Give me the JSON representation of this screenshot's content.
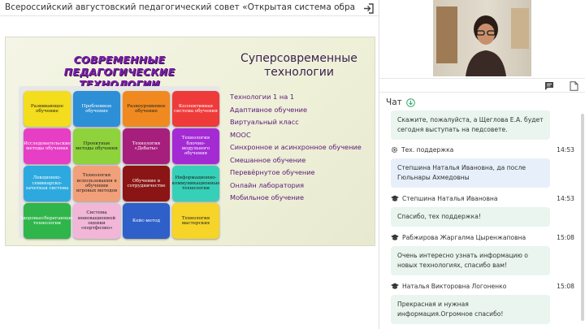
{
  "window": {
    "title": "Всероссийский августовский педагогический совет «Открытая система образования: от кон...",
    "exit_icon": "exit-icon"
  },
  "slide": {
    "banner_line1": "СОВРЕМЕННЫЕ ПЕДАГОГИЧЕСКИЕ",
    "banner_line2": "ТЕХНОЛОГИИ",
    "title_line1": "Суперсовременные",
    "title_line2": "технологии",
    "pieces": [
      {
        "label": "Развивающее обучение",
        "color": "#f3dd1c",
        "text_color": "#222222"
      },
      {
        "label": "Проблемное обучение",
        "color": "#2d8fd6",
        "text_color": "#ffffff"
      },
      {
        "label": "Разноуровневое обучение",
        "color": "#f08a20",
        "text_color": "#222222"
      },
      {
        "label": "Коллективная система обучения",
        "color": "#ef3a3a",
        "text_color": "#ffffff"
      },
      {
        "label": "Исследовательские методы обучения",
        "color": "#e63ec4",
        "text_color": "#ffffff"
      },
      {
        "label": "Проектные методы обучения",
        "color": "#8ed23c",
        "text_color": "#222222"
      },
      {
        "label": "Технология «Дебаты»",
        "color": "#a71f7c",
        "text_color": "#ffffff"
      },
      {
        "label": "Технология блочно-модульного обучения",
        "color": "#a42bd4",
        "text_color": "#ffffff"
      },
      {
        "label": "Лекционно-семинарско-зачетная система",
        "color": "#2da9df",
        "text_color": "#ffffff"
      },
      {
        "label": "Технология использования в обучении игровых методов",
        "color": "#f2a07a",
        "text_color": "#222222"
      },
      {
        "label": "Обучение в сотрудничестве",
        "color": "#8b1515",
        "text_color": "#ffffff"
      },
      {
        "label": "Информационно-коммуникационные технологии",
        "color": "#36d0b8",
        "text_color": "#222222"
      },
      {
        "label": "Здоровьесберегающие технологии",
        "color": "#2fb54a",
        "text_color": "#ffffff"
      },
      {
        "label": "Система инновационной оценки «портфолио»",
        "color": "#f2b6d9",
        "text_color": "#222222"
      },
      {
        "label": "Кейс-метод",
        "color": "#2f5fc8",
        "text_color": "#ffffff"
      },
      {
        "label": "Технология мастерских",
        "color": "#f6d428",
        "text_color": "#222222"
      }
    ],
    "list": [
      "Технологии 1 на 1",
      "Адаптивное обучение",
      "Виртуальный класс",
      "МООС",
      "Синхронное и асинхронное обучение",
      "Смешанное обучение",
      "Перевёрнутое обучение",
      "Онлайн лаборатория",
      "Мобильное обучение"
    ]
  },
  "panel": {
    "chat_tab_icon": "chat-bubble-icon",
    "files_tab_icon": "document-icon",
    "chat_label": "Чат",
    "chat_header_icon": "arrow-down-circle-icon"
  },
  "messages": [
    {
      "author": "",
      "time": "",
      "icon": "",
      "text": "Скажите, пожалуйста, а Щеглова Е.А. будет сегодня выступать на педсовете.",
      "style": "green"
    },
    {
      "author": "Тех. поддержка",
      "time": "14:53",
      "icon": "gear-icon",
      "text": "Степшина Наталья Ивановна, да после Гюльнары Ахмедовны",
      "style": "blue"
    },
    {
      "author": "Степшина Наталья Ивановна",
      "time": "14:53",
      "icon": "graduation-cap-icon",
      "text": "Спасибо, тех поддержка!",
      "style": "green"
    },
    {
      "author": "Рабжирова Жаргалма Цыренжаповна",
      "time": "15:08",
      "icon": "graduation-cap-icon",
      "text": "Очень интересно узнать информацию о новых технологиях, спасибо вам!",
      "style": "green"
    },
    {
      "author": "Наталья Викторовна Логоненко",
      "time": "15:08",
      "icon": "graduation-cap-icon",
      "text": "Прекрасная и нужная информация.Огромное спасибо!",
      "style": "green"
    }
  ]
}
